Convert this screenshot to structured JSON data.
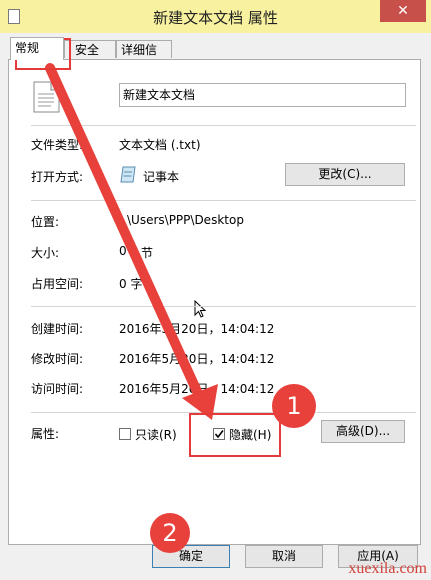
{
  "window": {
    "title": "新建文本文档 属性",
    "close": "✕"
  },
  "tabs": [
    "常规",
    "安全",
    "详细信息"
  ],
  "general": {
    "file_name": "新建文本文档",
    "type_label": "文件类型:",
    "type_value": "文本文档 (.txt)",
    "opens_with_label": "打开方式:",
    "opens_with_value": "记事本",
    "change_button": "更改(C)...",
    "location_label": "位置:",
    "location_value": "\\Users\\PPP\\Desktop",
    "size_label": "大小:",
    "size_value": "0",
    "size_value_2": "节",
    "disk_size_label": "占用空间:",
    "disk_size_value": "0 字",
    "created_label": "创建时间:",
    "created_value": "2016年5月20日，14:04:12",
    "modified_label": "修改时间:",
    "modified_value": "2016年5月20日，14:04:12",
    "accessed_label": "访问时间:",
    "accessed_value": "2016年5月20日，14:04:12",
    "attributes_label": "属性:",
    "readonly_label": "只读(R)",
    "hidden_label": "隐藏(H)",
    "hidden_checked": true,
    "advanced_button": "高级(D)..."
  },
  "footer": {
    "ok": "确定",
    "cancel": "取消",
    "apply": "应用(A)"
  },
  "annotations": {
    "step1": "1",
    "step2": "2",
    "colors": {
      "marker": "#e8403a"
    }
  },
  "watermark": "xuexila.com"
}
